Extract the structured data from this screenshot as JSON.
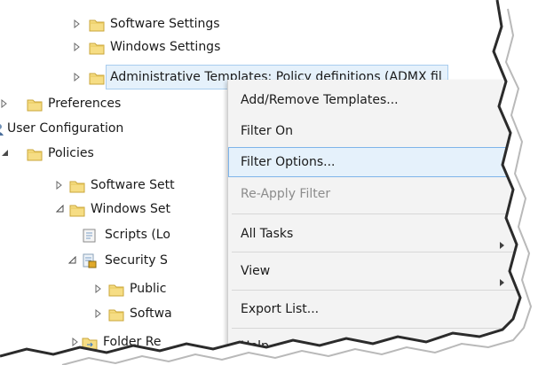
{
  "tree": {
    "items": [
      {
        "label": "Software Settings",
        "icon": "folder-icon",
        "expander": "collapsed"
      },
      {
        "label": "Windows Settings",
        "icon": "folder-icon",
        "expander": "collapsed"
      },
      {
        "label": "Administrative Templates: Policy definitions (ADMX fil",
        "icon": "folder-icon",
        "expander": "collapsed",
        "selected": true
      },
      {
        "label": "Preferences",
        "icon": "folder-icon",
        "expander": "collapsed"
      },
      {
        "label": "User Configuration",
        "icon": "user-config-icon",
        "expander": "none"
      },
      {
        "label": "Policies",
        "icon": "folder-icon",
        "expander": "expanded"
      },
      {
        "label": "Software Sett",
        "icon": "folder-icon",
        "expander": "collapsed"
      },
      {
        "label": "Windows Set",
        "icon": "folder-icon",
        "expander": "expanded"
      },
      {
        "label": "Scripts (Lo",
        "icon": "scripts-icon",
        "expander": "none"
      },
      {
        "label": "Security S",
        "icon": "security-settings-icon",
        "expander": "expanded"
      },
      {
        "label": "Public",
        "icon": "folder-icon",
        "expander": "collapsed"
      },
      {
        "label": "Softwa",
        "icon": "folder-icon",
        "expander": "collapsed"
      },
      {
        "label": "Folder Re",
        "icon": "folder-redirection-icon",
        "expander": "collapsed"
      }
    ]
  },
  "context_menu": {
    "items": [
      {
        "label": "Add/Remove Templates...",
        "state": "normal"
      },
      {
        "label": "Filter On",
        "state": "normal"
      },
      {
        "label": "Filter Options...",
        "state": "highlighted"
      },
      {
        "label": "Re-Apply Filter",
        "state": "disabled"
      },
      {
        "label": "All Tasks",
        "state": "normal",
        "submenu": true
      },
      {
        "label": "View",
        "state": "normal",
        "submenu": true
      },
      {
        "label": "Export List...",
        "state": "normal"
      },
      {
        "label": "Help",
        "state": "normal"
      }
    ]
  },
  "colors": {
    "highlight_bg": "#e5f1fb",
    "highlight_border": "#7eb4ea",
    "folder": "#f0d36b",
    "menu_bg": "#f3f3f3"
  }
}
